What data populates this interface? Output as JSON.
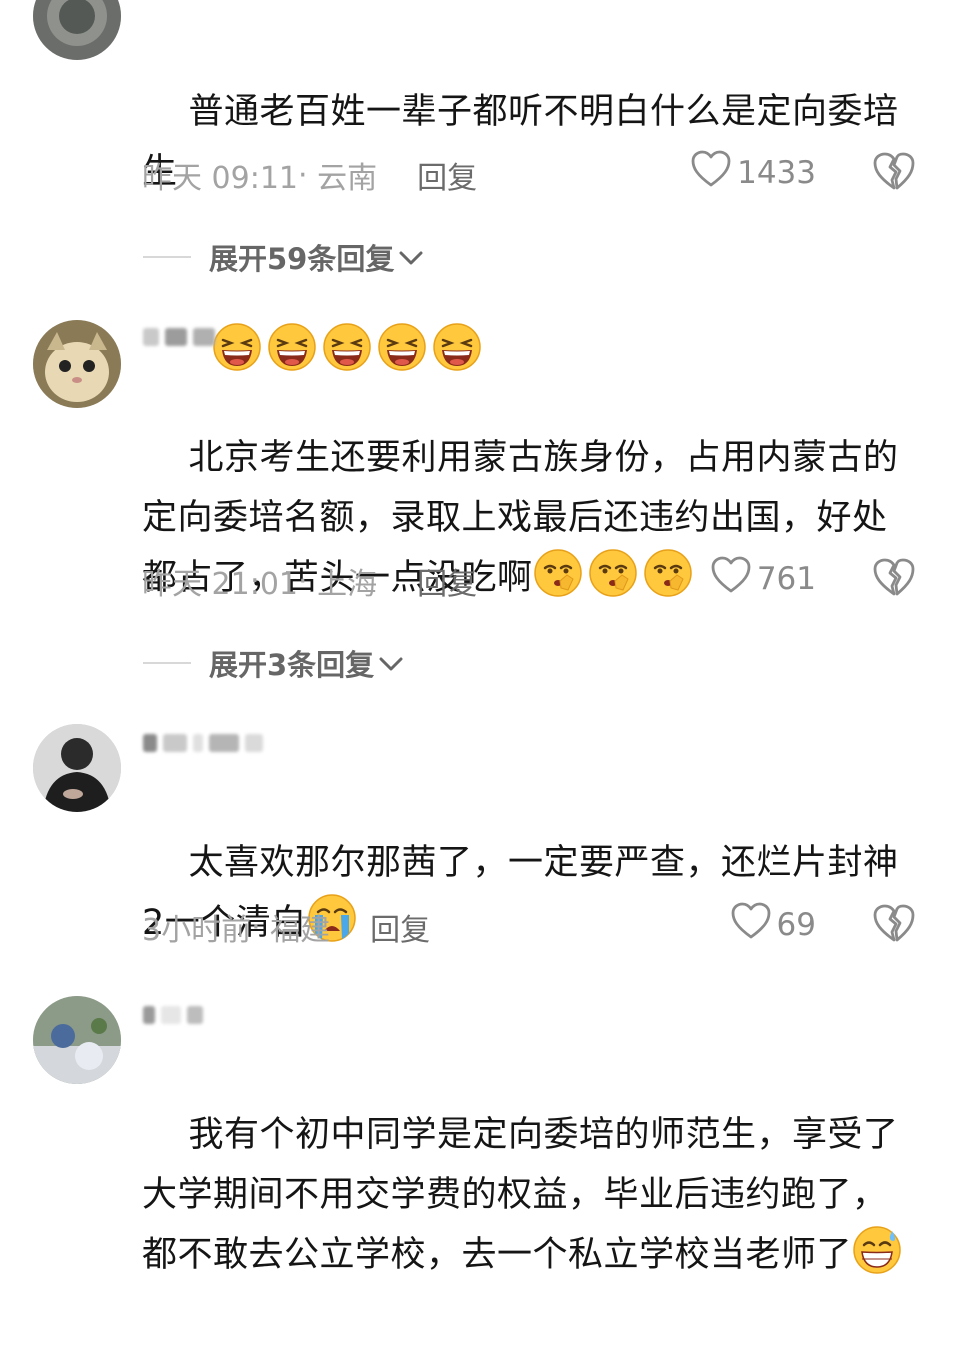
{
  "comments": [
    {
      "text": "普通老百姓一辈子都听不明白什么是定向委培生",
      "emoji": "laughing-face",
      "emoji_count": 5,
      "time": "昨天 09:11",
      "location": "云南",
      "reply_label": "回复",
      "likes": "1433",
      "expand_label": "展开59条回复"
    },
    {
      "text": "北京考生还要利用蒙古族身份，占用内蒙古的定向委培名额，录取上戏最后还违约出国，好处都占了，苦头一点没吃啊",
      "emoji": "shushing-face",
      "emoji_count": 3,
      "time": "昨天 21:01",
      "location": "上海",
      "reply_label": "回复",
      "likes": "761",
      "expand_label": "展开3条回复"
    },
    {
      "text": "太喜欢那尔那茜了，一定要严查，还烂片封神2一个清白",
      "emoji": "crying-face",
      "emoji_count": 1,
      "time": "3小时前",
      "location": "福建",
      "reply_label": "回复",
      "likes": "69"
    },
    {
      "text": "我有个初中同学是定向委培的师范生，享受了大学期间不用交学费的权益，毕业后违约跑了，都不敢去公立学校，去一个私立学校当老师了",
      "emoji": "grinning-sweat-face",
      "emoji_count": 1
    }
  ],
  "colors": {
    "text": "#151515",
    "meta": "#a3a3a3",
    "reply": "#6b6b6b",
    "emoji_yellow": "#FFC83D"
  }
}
